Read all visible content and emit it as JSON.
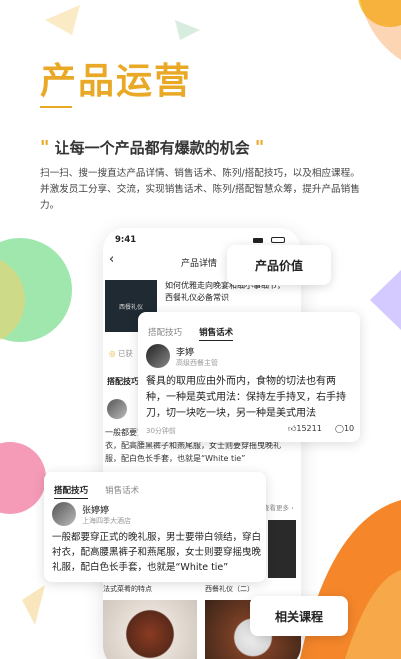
{
  "header": {
    "title": "产品运营",
    "slogan": "让每一个产品都有爆款的机会",
    "quote_open": "\"",
    "quote_close": "\"",
    "description": "扫一扫、搜一搜直达产品详情、销售话术、陈列/搭配技巧，以及相应课程。并激发员工分享、交流，实现销售话术、陈列/搭配智慧众筹，提升产品销售力。"
  },
  "phone": {
    "time": "9:41",
    "nav_title": "产品详情",
    "back": "‹",
    "course_title": "如何优雅走向晚宴和细小事细节，西餐礼仪必备常识",
    "thumb_label": "西餐礼仪",
    "earned": "已获",
    "section_label": "搭配技巧",
    "bg_text": "一般都要穿正式的晚礼服，男士要带白领结，穿白衬衣，配高腰黑裤子和燕尾服，女士则要穿摇曳晚礼服，配白色长手套，也就是“White tie”",
    "more": "查看更多 ›",
    "thumb1_label": "法式菜肴的特点",
    "thumb2_label": "西餐礼仪（二）"
  },
  "badge_value": "产品价值",
  "sales_card": {
    "tab1": "搭配技巧",
    "tab2": "销售话术",
    "name": "李婷",
    "role": "高级西餐主管",
    "text": "餐具的取用应由外而内，食物的切法也有两种，一种是英式用法：保持左手持叉，右手持刀，切一块吃一块，另一种是美式用法",
    "time": "30分钟前",
    "likes": "15211",
    "comments": "10"
  },
  "tip_card": {
    "tab1": "搭配技巧",
    "tab2": "销售话术",
    "name": "张婷婷",
    "org": "上海四季大酒店",
    "text": "一般都要穿正式的晚礼服，男士要带白领结，穿白衬衣，配高腰黑裤子和燕尾服，女士则要穿摇曳晚礼服，配白色长手套，也就是“White tie”"
  },
  "related_button": "相关课程",
  "colors": {
    "accent": "#e9a826",
    "orange": "#f5862a",
    "green": "#7fdc8b"
  }
}
